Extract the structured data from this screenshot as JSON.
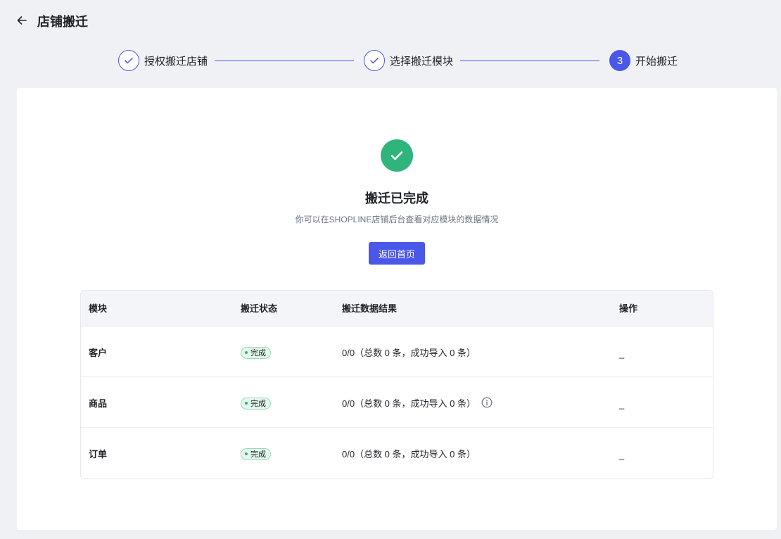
{
  "header": {
    "back_icon": "arrow-left-icon",
    "title": "店铺搬迁"
  },
  "steps": [
    {
      "label": "授权搬迁店铺",
      "status": "done",
      "icon": "check-icon"
    },
    {
      "label": "选择搬迁模块",
      "status": "done",
      "icon": "check-icon"
    },
    {
      "label": "开始搬迁",
      "status": "active",
      "number": "3"
    }
  ],
  "result": {
    "icon": "success-check-icon",
    "title": "搬迁已完成",
    "description": "你可以在SHOPLINE店铺后台查看对应模块的数据情况",
    "button_label": "返回首页"
  },
  "table": {
    "columns": [
      "模块",
      "搬迁状态",
      "搬迁数据结果",
      "操作"
    ],
    "rows": [
      {
        "module": "客户",
        "status": "完成",
        "result": "0/0（总数 0 条，成功导入 0 条）",
        "info": false,
        "op": "_"
      },
      {
        "module": "商品",
        "status": "完成",
        "result": "0/0（总数 0 条，成功导入 0 条）",
        "info": true,
        "op": "_"
      },
      {
        "module": "订单",
        "status": "完成",
        "result": "0/0（总数 0 条，成功导入 0 条）",
        "info": false,
        "op": "_"
      }
    ]
  },
  "colors": {
    "accent": "#4b57e8",
    "success": "#2fb57c",
    "background": "#f0f1f5"
  }
}
